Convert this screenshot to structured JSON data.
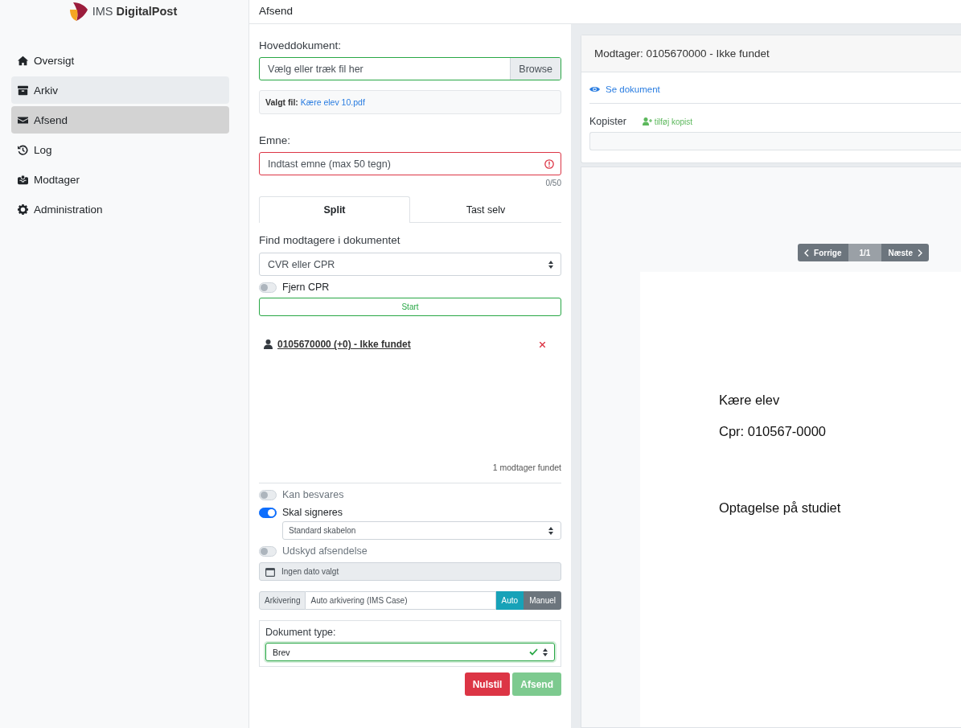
{
  "logo": {
    "text_light": "IMS",
    "text_bold": "DigitalPost"
  },
  "sidebar": {
    "items": [
      {
        "label": "Oversigt",
        "kind": "home",
        "selected": false,
        "hovered": false
      },
      {
        "label": "Arkiv",
        "kind": "archive",
        "selected": false,
        "hovered": true
      },
      {
        "label": "Afsend",
        "kind": "envelope",
        "selected": true,
        "hovered": false
      },
      {
        "label": "Log",
        "kind": "history",
        "selected": false,
        "hovered": false
      },
      {
        "label": "Modtager",
        "kind": "inbox",
        "selected": false,
        "hovered": false
      },
      {
        "label": "Administration",
        "kind": "gear",
        "selected": false,
        "hovered": false
      }
    ]
  },
  "header": {
    "title": "Afsend"
  },
  "form": {
    "main_document": {
      "label": "Hoveddokument:",
      "placeholder": "Vælg eller træk fil her",
      "button": "Browse"
    },
    "chosen_file": {
      "label": "Valgt fil:",
      "file": "Kære elev 10.pdf"
    },
    "subject": {
      "label": "Emne:",
      "placeholder": "Indtast emne (max 50 tegn)",
      "invalid": true,
      "counter": "0/50"
    },
    "tabs": [
      {
        "label": "Split",
        "selected": true
      },
      {
        "label": "Tast selv",
        "selected": false
      }
    ],
    "find": {
      "label": "Find modtagere i dokumentet",
      "select": "CVR eller CPR"
    },
    "remove_cpr": {
      "label": "Fjern CPR",
      "on": false
    },
    "start_button": "Start",
    "recipients": [
      {
        "text": "0105670000 (+0) - Ikke fundet"
      }
    ],
    "found_count": "1 modtager fundet",
    "can_reply": {
      "label": "Kan besvares",
      "on": false,
      "disabled": true
    },
    "sign": {
      "label": "Skal signeres",
      "on": true,
      "template": "Standard skabelon"
    },
    "delay": {
      "label": "Udskyd afsendelse",
      "on": false,
      "disabled": true,
      "date_placeholder": "Ingen dato valgt"
    },
    "archiving": {
      "label": "Arkivering",
      "value": "Auto arkivering (IMS Case)",
      "modes": [
        {
          "label": "Auto",
          "selected": true
        },
        {
          "label": "Manuel",
          "selected": false
        }
      ]
    },
    "document_type": {
      "label": "Dokument type:",
      "value": "Brev",
      "valid": true
    },
    "buttons": [
      {
        "label": "Nulstil",
        "kind": "danger",
        "disabled": false
      },
      {
        "label": "Afsend",
        "kind": "success",
        "disabled": true
      }
    ]
  },
  "preview": {
    "recipient_title": "Modtager: 0105670000 - Ikke fundet",
    "view_link": "Se dokument",
    "copies_label": "Kopister",
    "add_copy": "tilføj kopist",
    "pager": {
      "prev": "Forrige",
      "page": "1/1",
      "next": "Næste"
    },
    "page_lines": [
      "Kære elev",
      "Cpr: 010567-0000",
      "Optagelse på studiet"
    ]
  }
}
